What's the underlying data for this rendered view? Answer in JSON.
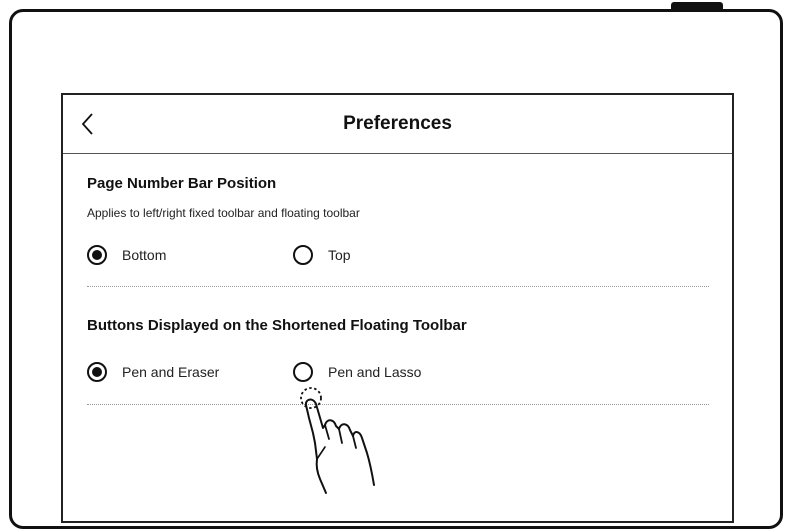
{
  "header": {
    "title": "Preferences",
    "back_icon": "chevron-left-icon"
  },
  "sections": [
    {
      "title": "Page Number Bar Position",
      "description": "Applies to left/right fixed toolbar and floating toolbar",
      "options": [
        {
          "label": "Bottom",
          "selected": true
        },
        {
          "label": "Top",
          "selected": false
        }
      ]
    },
    {
      "title": "Buttons Displayed on the Shortened Floating Toolbar",
      "options": [
        {
          "label": "Pen and Eraser",
          "selected": true
        },
        {
          "label": "Pen and Lasso",
          "selected": false
        }
      ]
    }
  ],
  "illustration": {
    "icon": "tap-hand-icon"
  }
}
